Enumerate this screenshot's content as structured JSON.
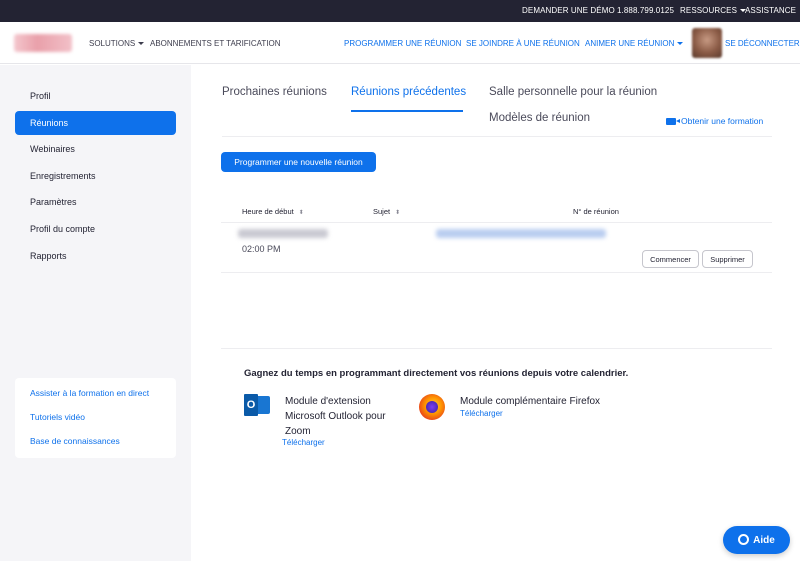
{
  "topbar": {
    "demo": "DEMANDER UNE DÉMO",
    "phone": "1.888.799.0125",
    "resources": "RESSOURCES",
    "support": "ASSISTANCE"
  },
  "nav": {
    "solutions": "SOLUTIONS",
    "pricing": "ABONNEMENTS ET TARIFICATION",
    "schedule": "PROGRAMMER UNE RÉUNION",
    "join": "SE JOINDRE À UNE RÉUNION",
    "host": "ANIMER UNE RÉUNION",
    "signout": "SE DÉCONNECTER"
  },
  "sidebar": {
    "items": [
      {
        "label": "Profil"
      },
      {
        "label": "Réunions"
      },
      {
        "label": "Webinaires"
      },
      {
        "label": "Enregistrements"
      },
      {
        "label": "Paramètres"
      },
      {
        "label": "Profil du compte"
      },
      {
        "label": "Rapports"
      }
    ],
    "links": [
      {
        "label": "Assister à la formation en direct"
      },
      {
        "label": "Tutoriels vidéo"
      },
      {
        "label": "Base de connaissances"
      }
    ]
  },
  "tabs": {
    "upcoming": "Prochaines réunions",
    "previous": "Réunions précédentes",
    "personal_room": "Salle personnelle pour la réunion",
    "templates": "Modèles de réunion",
    "training": "Obtenir une formation"
  },
  "actions": {
    "schedule_new": "Programmer une nouvelle réunion"
  },
  "table": {
    "headers": {
      "start_time": "Heure de début",
      "topic": "Sujet",
      "meeting_id": "N° de réunion"
    },
    "rows": [
      {
        "time": "02:00 PM",
        "start": "Commencer",
        "delete": "Supprimer"
      }
    ]
  },
  "calendar": {
    "title": "Gagnez du temps en programmant directement vos réunions depuis votre calendrier.",
    "outlook": {
      "name": "Module d'extension Microsoft Outlook pour Zoom",
      "download": "Télécharger"
    },
    "firefox": {
      "name": "Module complémentaire Firefox",
      "download": "Télécharger"
    }
  },
  "help": {
    "label": "Aide"
  },
  "colors": {
    "accent": "#0e71eb",
    "topbar": "#232333",
    "sidebar": "#f5f5f8"
  }
}
